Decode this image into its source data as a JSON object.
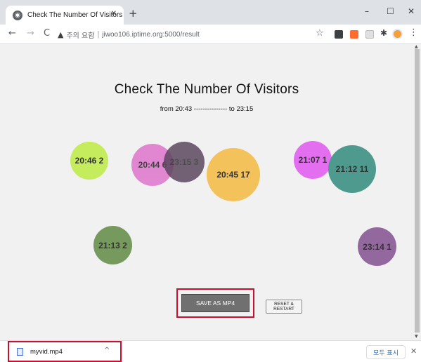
{
  "browser": {
    "tab_title": "Check The Number Of Visitors",
    "tab_close": "✕",
    "new_tab": "+",
    "minimize": "–",
    "maximize": "☐",
    "close": "✕",
    "nav_back": "←",
    "nav_forward": "→",
    "reload": "C",
    "security_icon": "▲",
    "security_label": "주의 요함",
    "url_separator": "|",
    "url": "jiwoo106.iptime.org:5000/result",
    "star": "☆",
    "menu": "⋮",
    "extension_colors": [
      "#3c4043",
      "#ff6d2e",
      "#dadce0"
    ]
  },
  "page": {
    "title": "Check The Number Of Visitors",
    "subtitle": "from 20:43 --------------- to 23:15",
    "bubbles": [
      {
        "label": "20:46 2",
        "color": "#c5ec5c"
      },
      {
        "label": "20:44 6",
        "color": "#e07fd0"
      },
      {
        "label": "23:15 3",
        "color": "#5c4760"
      },
      {
        "label": "20:45 17",
        "color": "#f3c25a"
      },
      {
        "label": "21:07 1",
        "color": "#e36ff0"
      },
      {
        "label": "21:12 11",
        "color": "#4f9a8e"
      },
      {
        "label": "21:13 2",
        "color": "#769a5d"
      },
      {
        "label": "23:14 1",
        "color": "#93689e"
      }
    ],
    "save_button": "SAVE AS MP4",
    "reset_line1": "RESET &",
    "reset_line2": "RESTART"
  },
  "downloads": {
    "file_name": "myvid.mp4",
    "chevron": "^",
    "show_all": "모두 표시",
    "close": "✕"
  }
}
